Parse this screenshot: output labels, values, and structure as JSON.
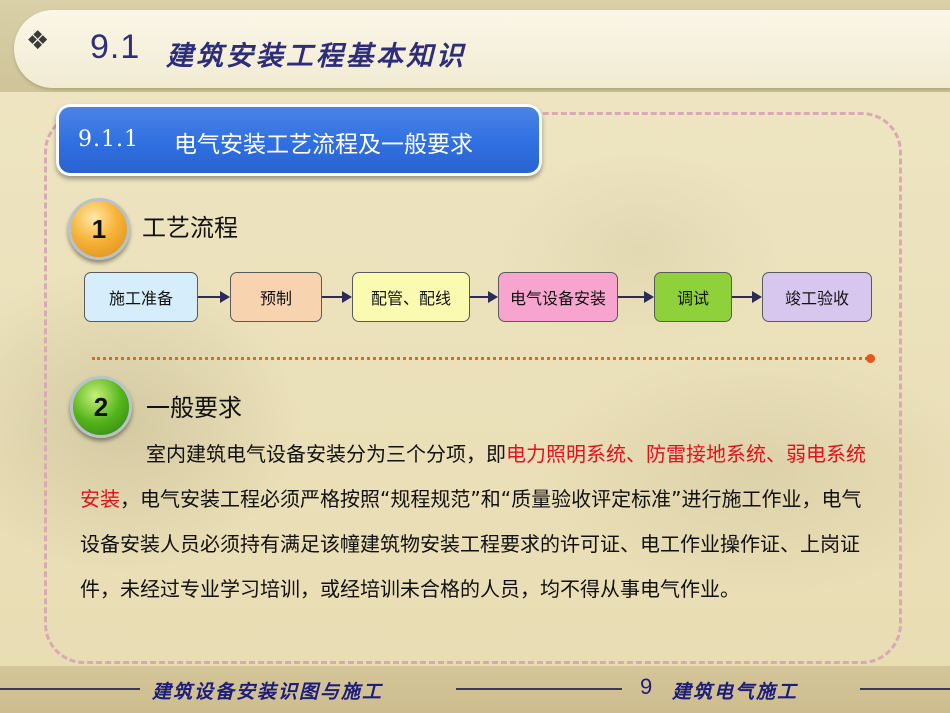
{
  "header": {
    "bullet": "❖",
    "number": "9.1",
    "title": "建筑安装工程基本知识"
  },
  "section": {
    "number": "9.1.1",
    "title": "电气安装工艺流程及一般要求"
  },
  "steps": [
    {
      "badge": "1",
      "label": "工艺流程"
    },
    {
      "badge": "2",
      "label": "一般要求"
    }
  ],
  "flow": {
    "items": [
      {
        "label": "施工准备",
        "color": "#d6eefb"
      },
      {
        "label": "预制",
        "color": "#f7d3b0"
      },
      {
        "label": "配管、配线",
        "color": "#fafab0"
      },
      {
        "label": "电气设备安装",
        "color": "#f7a5cf"
      },
      {
        "label": "调试",
        "color": "#8fd13a"
      },
      {
        "label": "竣工验收",
        "color": "#d7c7ef"
      }
    ]
  },
  "requirements": {
    "segments": [
      {
        "text": "室内建筑电气设备安装分为三个分项，即",
        "highlight": false
      },
      {
        "text": "电力照明系统、防雷接地系统、弱电系统安装",
        "highlight": true
      },
      {
        "text": "，电气安装工程必须严格按照“规程规范”和“质量验收评定标准”进行施工作业，电气设备安装人员必须持有满足该幢建筑物安装工程要求的许可证、电工作业操作证、上岗证件，未经过专业学习培训，或经培训未合格的人员，均不得从事电气作业。",
        "highlight": false
      }
    ],
    "highlight_color": "#e5101c"
  },
  "footer": {
    "book_title": "建筑设备安装识图与施工",
    "chapter_number": "9",
    "chapter_title": "建筑电气施工"
  }
}
